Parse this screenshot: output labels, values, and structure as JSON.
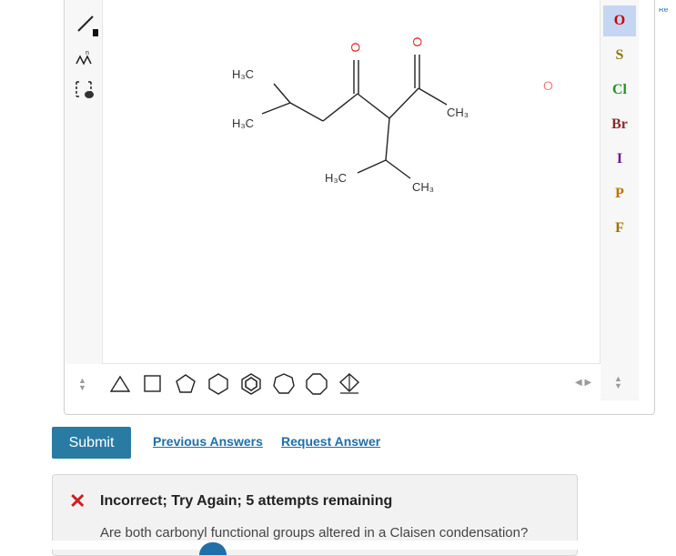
{
  "editor": {
    "left_tools": [
      {
        "name": "single-bond-tool",
        "icon": "single-bond-icon"
      },
      {
        "name": "chain-tool",
        "icon": "chain-icon"
      },
      {
        "name": "select-tool",
        "icon": "lasso-select-icon"
      }
    ],
    "molecule_labels": {
      "h3c_top": "H₃C",
      "h3c_mid": "H₃C",
      "ch3_right": "CH₃",
      "h3c_low": "H₃C",
      "ch3_low": "CH₃",
      "o_left": "O",
      "o_right": "O",
      "o_stray": "O"
    },
    "elements": [
      {
        "symbol": "O",
        "color": "#cc0000",
        "selected": true
      },
      {
        "symbol": "S",
        "color": "#8a7a00",
        "selected": false
      },
      {
        "symbol": "Cl",
        "color": "#1a9a1a",
        "selected": false
      },
      {
        "symbol": "Br",
        "color": "#8a2a2a",
        "selected": false
      },
      {
        "symbol": "I",
        "color": "#6a1a8a",
        "selected": false
      },
      {
        "symbol": "P",
        "color": "#c07000",
        "selected": false
      },
      {
        "symbol": "F",
        "color": "#a07000",
        "selected": false
      }
    ],
    "ring_templates": [
      "cyclopropane",
      "cyclobutane",
      "cyclopentane",
      "cyclohexane",
      "benzene",
      "cycloheptane",
      "cyclooctane",
      "chair-cyclohexane"
    ]
  },
  "actions": {
    "submit_label": "Submit",
    "previous_answers_label": "Previous Answers",
    "request_answer_label": "Request Answer"
  },
  "feedback": {
    "status": "Incorrect; Try Again; 5 attempts remaining",
    "hint": "Are both carbonyl functional groups altered in a Claisen condensation?"
  }
}
